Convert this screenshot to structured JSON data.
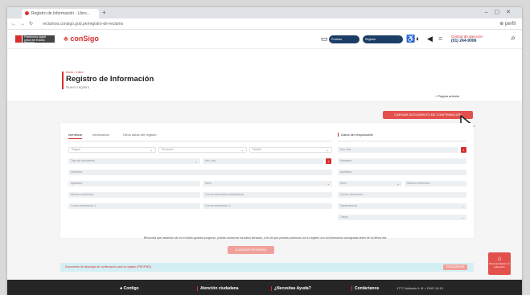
{
  "browser": {
    "tab_title": "Registro de Información · Libro...",
    "url": "reclamos.consigo.gob.pe/registro-de-reclamo",
    "address_right": "⊕  perfil"
  },
  "site": {
    "gov_label": "Plataforma digital única del Estado Peruano",
    "logo_text": "conSigo",
    "tool_labels": [
      "Pruebas",
      "Registro"
    ],
    "phone_label": "Central de atención",
    "phone_number": "(01) 244-9006"
  },
  "page": {
    "breadcrumb": "Inicio / Libro",
    "title": "Registro de Información",
    "subtitle": "Nuevo registro",
    "home_link": "+ Página anterior"
  },
  "cta_label": "CARGAR DOCUMENTO DE CONFIRMACIÓN",
  "form": {
    "tabs": [
      "Identificar",
      "Información",
      "Otros datos del registro"
    ],
    "right_title": "Datos del responsable",
    "left_fields": [
      [
        "Región",
        "Provincia",
        "Distrito"
      ],
      [
        "Tipo de documento",
        "Nro. doc."
      ],
      [
        "Nombres"
      ],
      [
        "Apellidos",
        "Sexo"
      ],
      [
        "Número telefónico",
        "Correo electrónico institucional"
      ],
      [
        "Correo electrónico 1",
        "Correo electrónico 2"
      ]
    ],
    "right_fields": [
      "Nro. doc.",
      "Nombres",
      "Apellidos",
      "Sexo",
      "Número telefónico",
      "Correo electrónico",
      "Dependencia",
      "Cargo"
    ]
  },
  "note": "Recuerda que haciendo clic en el botón guardar progreso, podrás conservar los datos llenados, a fin de que puedas continuar con tu registro con la información consignada antes de la última vez.",
  "save_label": "GUARDAR PROGRESO",
  "alert": {
    "text": "Documento de descarga de confirmación para tu registro (PDF/PNG)",
    "button": "DESCARGAR"
  },
  "fab": {
    "label": "Recomendación en educación"
  },
  "footer": {
    "items": [
      "Contigo",
      "Atención ciudadana",
      "¿Necesitas Ayuda?",
      "Contáctanos"
    ],
    "taskbar": "17°C  Nublado  ∧  ⊕  ⌂  ENG  10:15"
  },
  "colors": {
    "brand_red": "#d62e2e",
    "cta_red": "#e3514c",
    "navy": "#1c3e66",
    "alert_bg": "#d3eff3"
  }
}
